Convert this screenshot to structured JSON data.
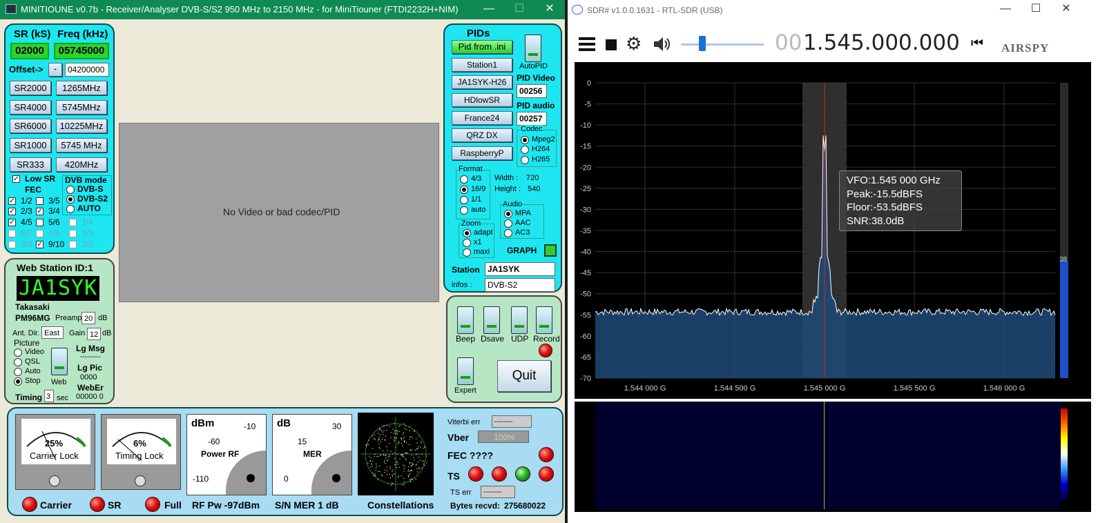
{
  "minitioune": {
    "title": "MINITIOUNE v0.7b - Receiver/Analyser DVB-S/S2 950 MHz to 2150 MHz - for MiniTiouner (FTDI2232H+NIM)",
    "window_buttons": [
      "—",
      "☐",
      "✕"
    ],
    "sr_header": "SR (kS)",
    "freq_header": "Freq (kHz)",
    "sr_value": "02000",
    "freq_value": "05745000",
    "offset_label": "Offset->",
    "offset_minus": "-",
    "offset_value": "04200000",
    "sr_buttons": [
      "SR2000",
      "SR4000",
      "SR6000",
      "SR1000",
      "SR333"
    ],
    "freq_buttons": [
      "1265MHz",
      "5745MHz",
      "10225MHz",
      "5745 MHz",
      "420MHz"
    ],
    "low_sr_label": "Low SR",
    "fec_label": "FEC",
    "dvb_mode_label": "DVB mode",
    "dvb_modes": [
      "DVB-S",
      "DVB-S2",
      "AUTO"
    ],
    "fec_items": [
      "1/2",
      "3/5",
      "2/3",
      "3/4",
      "4/5",
      "5/6",
      "6/7",
      "7/8",
      "8/9",
      "9/10"
    ],
    "fec_extra": [
      "1/4",
      "1/3",
      "2/5"
    ],
    "video_msg": "No Video or bad codec/PID",
    "web_station_title": "Web Station ID:1",
    "callsign_display": "JA1SYK",
    "location": "Takasaki",
    "locator": "PM96MG",
    "preamp_label": "Preamp",
    "preamp_value": "20",
    "preamp_unit": "dB",
    "ant_dir_label": "Ant. Dir.",
    "ant_dir_value": "East",
    "gain_label": "Gain",
    "gain_value": "12",
    "gain_unit": "dB",
    "picture_label": "Picture",
    "picture_options": [
      "Video",
      "QSL",
      "Auto",
      "Stop"
    ],
    "web_label": "Web",
    "lg_msg": "Lg Msg",
    "lg_msg_value": "---------",
    "lg_pic": "Lg Pic",
    "lg_pic_value": "0000",
    "web_err": "WebEr",
    "web_err_value": "00000  0",
    "timing_label": "Timing",
    "timing_value": "3",
    "timing_unit": "sec",
    "pids_title": "PIDs",
    "pid_buttons": [
      "Pid from .ini",
      "Station1",
      "JA1SYK-H26",
      "HDlowSR",
      "France24",
      "QRZ DX",
      "RaspberryP"
    ],
    "autopid_label": "AutoPID",
    "pid_video_label": "PID Video",
    "pid_video_value": "00256",
    "pid_audio_label": "PID audio",
    "pid_audio_value": "00257",
    "codec_label": "Codec",
    "codec_options": [
      "Mpeg2",
      "H264",
      "H265"
    ],
    "format_label": "Format",
    "format_options": [
      "4/3",
      "16/9",
      "1/1",
      "auto"
    ],
    "width_label": "Width :",
    "width_value": "720",
    "height_label": "Height :",
    "height_value": "540",
    "audio_label": "Audio",
    "audio_options": [
      "MPA",
      "AAC",
      "AC3"
    ],
    "zoom_label": "Zoom",
    "zoom_options": [
      "adapt",
      "x1",
      "maxi"
    ],
    "graph_label": "GRAPH",
    "station_label": "Station",
    "station_value": "JA1SYK",
    "infos_label": "infos :",
    "infos_value": "DVB-S2",
    "toggles": [
      "Beep",
      "Dsave",
      "UDP",
      "Record",
      "Expert"
    ],
    "quit_label": "Quit",
    "carrier_lock_pct": "25%",
    "carrier_lock_label": "Carrier Lock",
    "timing_lock_pct": "6%",
    "timing_lock_label": "Timing Lock",
    "power_rf_unit": "dBm",
    "power_rf_label": "Power RF",
    "power_rf_ticks": [
      "-10",
      "-60",
      "-110"
    ],
    "mer_unit": "dB",
    "mer_label": "MER",
    "mer_ticks": [
      "30",
      "15",
      "0"
    ],
    "viterbi_label": "Viterbi err",
    "viterbi_value": "--------",
    "vber_label": "Vber",
    "vber_value": "100%",
    "fec_status": "FEC ????",
    "ts_label": "TS",
    "ts_err_label": "TS err",
    "ts_err_value": "--------",
    "bytes_label": "Bytes recvd:",
    "bytes_value": "275680022",
    "bottom_labels": [
      "Carrier",
      "SR",
      "Full",
      "RF Pw  -97dBm",
      "S/N MER  1 dB",
      "Constellations"
    ]
  },
  "sdr": {
    "title": "SDR# v1.0.0.1631 - RTL-SDR (USB)",
    "window_buttons": [
      "—",
      "☐",
      "✕"
    ],
    "freq_dim": "00",
    "freq_main": "1.545.000.000",
    "logo": "AIRSPY",
    "y_ticks": [
      "0",
      "-5",
      "-10",
      "-15",
      "-20",
      "-25",
      "-30",
      "-35",
      "-40",
      "-45",
      "-50",
      "-55",
      "-60",
      "-65",
      "-70"
    ],
    "x_ticks": [
      "1.544 000 G",
      "1.544 500 G",
      "1.545 000 G",
      "1.545 500 G",
      "1.546 000 G"
    ],
    "tooltip": [
      "VFO:1.545 000 GHz",
      "Peak:-15.5dBFS",
      "Floor:-53.5dBFS",
      "SNR:38.0dB"
    ],
    "snr_bar_value": "38"
  }
}
